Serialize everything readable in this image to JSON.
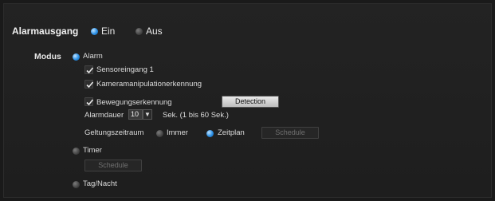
{
  "alarm_output": {
    "label": "Alarmausgang",
    "on_label": "Ein",
    "off_label": "Aus",
    "selected": "on"
  },
  "mode": {
    "label": "Modus",
    "alarm": {
      "label": "Alarm",
      "checks": [
        {
          "label": "Sensoreingang 1",
          "checked": true
        },
        {
          "label": "Kameramanipulationerkennung",
          "checked": true
        },
        {
          "label": "Bewegungserkennung",
          "checked": true
        }
      ],
      "detection_button": "Detection",
      "duration": {
        "label": "Alarmdauer",
        "value": "10",
        "arrow": "▼",
        "suffix": "Sek. (1 bis 60 Sek.)"
      },
      "validity": {
        "label": "Geltungszeitraum",
        "always_label": "Immer",
        "schedule_label": "Zeitplan",
        "selected": "schedule",
        "schedule_button": "Schedule"
      }
    },
    "timer": {
      "label": "Timer",
      "schedule_button": "Schedule"
    },
    "daynight": {
      "label": "Tag/Nacht"
    }
  },
  "colors": {
    "accent": "#2a8fe6",
    "background": "#1e1e1e"
  }
}
